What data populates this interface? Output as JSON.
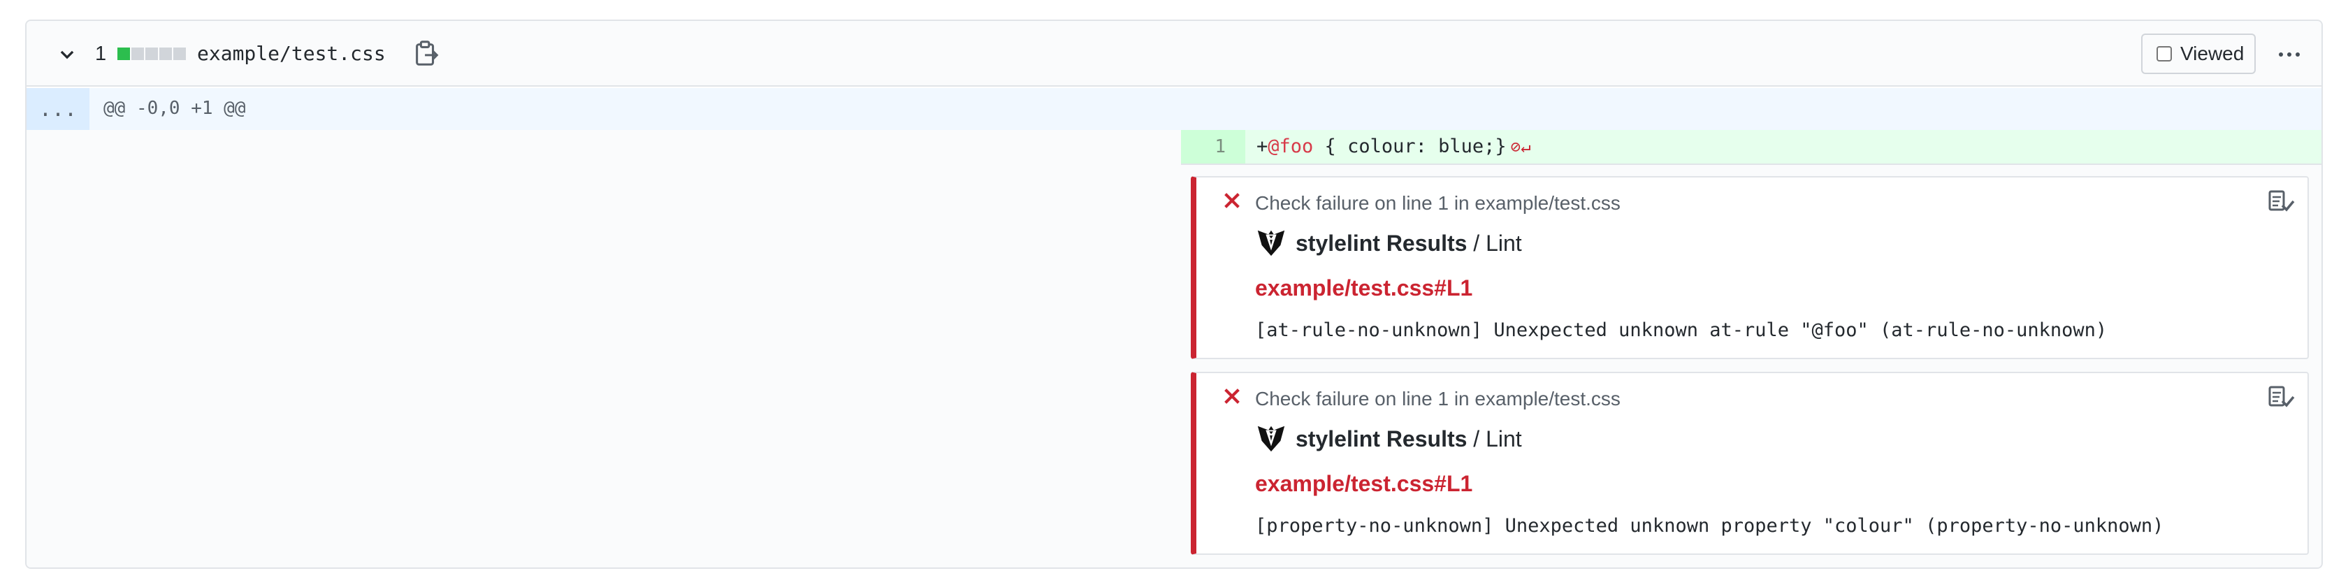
{
  "file": {
    "change_count": "1",
    "diffstat": [
      "add",
      "neutral",
      "neutral",
      "neutral",
      "neutral"
    ],
    "name": "example/test.css",
    "viewed_label": "Viewed",
    "viewed_checked": false
  },
  "hunk": {
    "expander_label": "...",
    "header": "@@ -0,0 +1 @@"
  },
  "added_line": {
    "number": "1",
    "prefix": "+",
    "at_rule": "@foo",
    "rest": " { colour: blue;}",
    "no_newline_marker": "⊘↵"
  },
  "annotations": [
    {
      "title": "Check failure on line 1 in example/test.css",
      "app_name": "stylelint Results",
      "app_suffix": " / Lint",
      "link": "example/test.css#L1",
      "message": "[at-rule-no-unknown] Unexpected unknown at-rule \"@foo\" (at-rule-no-unknown)"
    },
    {
      "title": "Check failure on line 1 in example/test.css",
      "app_name": "stylelint Results",
      "app_suffix": " / Lint",
      "link": "example/test.css#L1",
      "message": "[property-no-unknown] Unexpected unknown property \"colour\" (property-no-unknown)"
    }
  ],
  "colors": {
    "failure": "#cb2431",
    "addition_bg": "#e6ffed",
    "addition_num_bg": "#cdffd8",
    "hunk_bg": "#f1f8ff",
    "diffstat_add": "#2cbe4e",
    "diffstat_neutral": "#d1d5da"
  },
  "icons": {
    "collapse": "chevron-down-icon",
    "copy": "clipboard-copy-icon",
    "more": "kebab-horizontal-icon",
    "failure": "x-icon",
    "app": "stylelint-bowtie-icon",
    "check": "checklist-icon"
  }
}
